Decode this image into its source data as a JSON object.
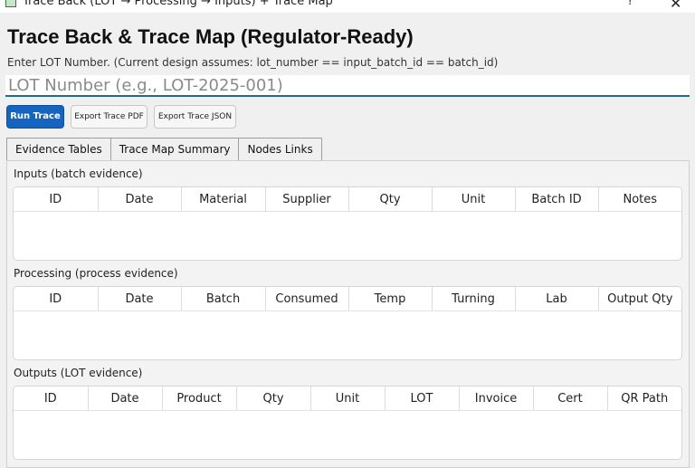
{
  "window": {
    "title": "Trace Back (LOT → Processing → Inputs) + Trace Map",
    "help_glyph": "?",
    "close_glyph": "✕"
  },
  "header": {
    "title": "Trace Back & Trace Map (Regulator-Ready)",
    "hint": "Enter LOT Number. (Current design assumes: lot_number == input_batch_id == batch_id)"
  },
  "lot_input": {
    "value": "",
    "placeholder": "LOT Number (e.g., LOT-2025-001)"
  },
  "toolbar": {
    "run_label": "Run Trace",
    "export_pdf_label": "Export Trace PDF",
    "export_json_label": "Export Trace JSON"
  },
  "tabs": [
    {
      "label": "Evidence Tables",
      "active": true
    },
    {
      "label": "Trace Map Summary",
      "active": false
    },
    {
      "label": "Nodes  Links",
      "active": false
    }
  ],
  "inputs_section": {
    "label": "Inputs (batch evidence)",
    "columns": [
      "ID",
      "Date",
      "Material",
      "Supplier",
      "Qty",
      "Unit",
      "Batch ID",
      "Notes"
    ]
  },
  "processing_section": {
    "label": "Processing (process evidence)",
    "columns": [
      "ID",
      "Date",
      "Batch",
      "Consumed",
      "Temp",
      "Turning",
      "Lab",
      "Output Qty"
    ]
  },
  "outputs_section": {
    "label": "Outputs (LOT evidence)",
    "columns": [
      "ID",
      "Date",
      "Product",
      "Qty",
      "Unit",
      "LOT",
      "Invoice",
      "Cert",
      "QR Path"
    ]
  },
  "colors": {
    "primary": "#1565c0",
    "input_underline": "#1f6f8b"
  }
}
